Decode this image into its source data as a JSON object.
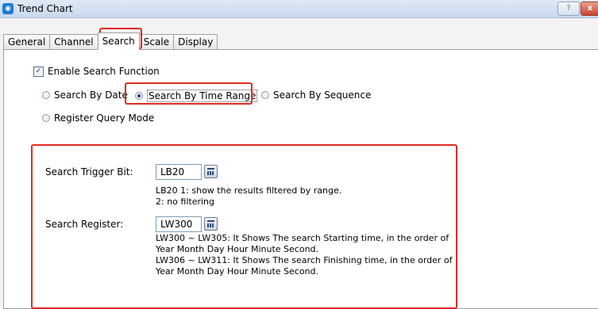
{
  "window": {
    "title": "Trend Chart",
    "help_label": "?",
    "close_label": "x"
  },
  "tabs": [
    {
      "label": "General",
      "active": false
    },
    {
      "label": "Channel",
      "active": false
    },
    {
      "label": "Search",
      "active": true
    },
    {
      "label": "Scale",
      "active": false
    },
    {
      "label": "Display",
      "active": false
    }
  ],
  "search": {
    "enable_label": "Enable Search Function",
    "enable_checked": true,
    "modes": [
      {
        "label": "Search By Date",
        "selected": false
      },
      {
        "label": "Search By Time Range",
        "selected": true
      },
      {
        "label": "Search By Sequence",
        "selected": false
      },
      {
        "label": "Register Query Mode",
        "selected": false
      }
    ],
    "trigger": {
      "label": "Search Trigger Bit:",
      "value": "LB20",
      "desc_line1": "LB20 1: show the results filtered by range.",
      "desc_line2": "2: no filtering"
    },
    "register": {
      "label": "Search Register:",
      "value": "LW300",
      "desc_line1": "LW300 ~ LW305: It Shows The search Starting time, in the order of",
      "desc_line2": "Year Month Day Hour Minute Second.",
      "desc_line3": "LW306 ~ LW311: It Shows The search Finishing time, in the order of",
      "desc_line4": "Year Month Day Hour Minute Second."
    }
  },
  "highlight_color": "#e02b20"
}
